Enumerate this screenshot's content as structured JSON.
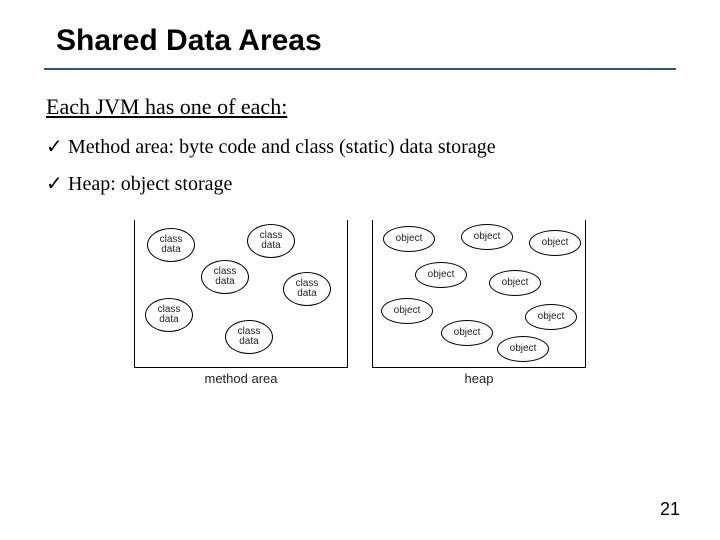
{
  "title": "Shared Data Areas",
  "subhead": "Each JVM has one of each:",
  "bullets": [
    "Method area: byte code and class (static) data storage",
    "Heap: object storage"
  ],
  "diagram": {
    "method_area": {
      "label": "method area",
      "item_text": "class\ndata",
      "count": 6
    },
    "heap": {
      "label": "heap",
      "item_text": "object",
      "count": 9
    }
  },
  "page_number": "21",
  "checkmark": "✓"
}
